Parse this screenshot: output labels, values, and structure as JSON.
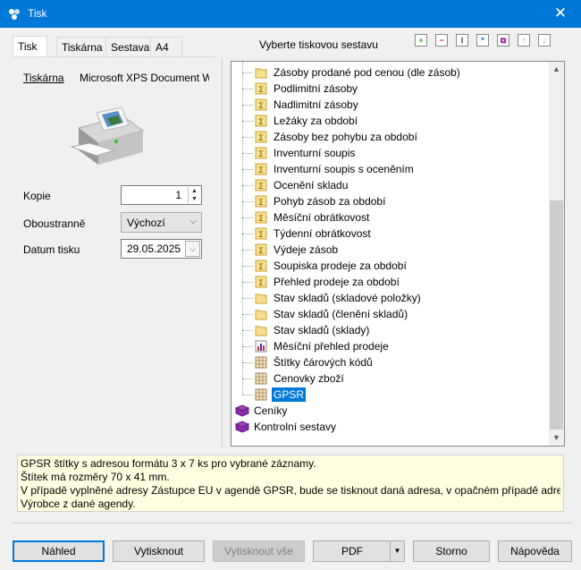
{
  "window": {
    "title": "Tisk",
    "close_glyph": "✕"
  },
  "tabs": [
    {
      "label": "Tisk"
    },
    {
      "label": "Tiskárna"
    },
    {
      "label": "Sestava"
    },
    {
      "label": "A4"
    }
  ],
  "printer": {
    "label": "Tiskárna",
    "name": "Microsoft XPS Document W"
  },
  "copies": {
    "label": "Kopie",
    "value": "1"
  },
  "duplex": {
    "label": "Oboustranně",
    "value": "Výchozí"
  },
  "print_date": {
    "label": "Datum tisku",
    "value": "29.05.2025"
  },
  "report_picker": {
    "title": "Vyberte tiskovou sestavu"
  },
  "toolbar_icons": [
    "add-icon",
    "remove-icon",
    "info-icon",
    "star-icon",
    "copy-icon",
    "move-up-icon",
    "move-down-icon"
  ],
  "tree": {
    "items": [
      {
        "label": "Zásoby prodané pod cenou (dle zásob)",
        "icon": "folder-icon"
      },
      {
        "label": "Podlimitní zásoby",
        "icon": "sum-icon"
      },
      {
        "label": "Nadlimitní zásoby",
        "icon": "sum-icon"
      },
      {
        "label": "Ležáky za období",
        "icon": "sum-icon"
      },
      {
        "label": "Zásoby bez pohybu za období",
        "icon": "sum-icon"
      },
      {
        "label": "Inventurní soupis",
        "icon": "sum-icon"
      },
      {
        "label": "Inventurní soupis s oceněním",
        "icon": "sum-icon"
      },
      {
        "label": "Ocenění skladu",
        "icon": "sum-icon"
      },
      {
        "label": "Pohyb zásob za období",
        "icon": "sum-icon"
      },
      {
        "label": "Měsíční obrátkovost",
        "icon": "sum-icon"
      },
      {
        "label": "Týdenní obrátkovost",
        "icon": "sum-icon"
      },
      {
        "label": "Výdeje zásob",
        "icon": "sum-icon"
      },
      {
        "label": "Soupiska prodeje za období",
        "icon": "sum-icon"
      },
      {
        "label": "Přehled prodeje za období",
        "icon": "sum-icon"
      },
      {
        "label": "Stav skladů (skladové položky)",
        "icon": "folder-icon"
      },
      {
        "label": "Stav skladů (členění skladů)",
        "icon": "folder-icon"
      },
      {
        "label": "Stav skladů (sklady)",
        "icon": "folder-icon"
      },
      {
        "label": "Měsíční přehled prodeje",
        "icon": "chart-icon"
      },
      {
        "label": "Štítky čárových kódů",
        "icon": "grid-icon"
      },
      {
        "label": "Cenovky zboží",
        "icon": "grid-icon"
      },
      {
        "label": "GPSR",
        "icon": "grid-icon"
      }
    ],
    "groups": [
      {
        "label": "Ceníky",
        "icon": "book-icon"
      },
      {
        "label": "Kontrolní sestavy",
        "icon": "book-icon"
      }
    ],
    "selected": "GPSR"
  },
  "description": {
    "lines": [
      "GPSR štítky s adresou formátu 3 x 7 ks pro vybrané záznamy.",
      "Štítek má rozměry 70 x 41 mm.",
      "V případě vyplněné adresy Zástupce EU v agendě GPSR, bude se tisknout daná adresa, v opačném případě adresa",
      "Výrobce z dané agendy."
    ]
  },
  "buttons": {
    "preview": "Náhled",
    "print": "Vytisknout",
    "print_all": "Vytisknout vše",
    "pdf": "PDF",
    "cancel": "Storno",
    "help": "Nápověda"
  },
  "colors": {
    "accent": "#0078d7",
    "description_bg": "#ffffe1"
  }
}
